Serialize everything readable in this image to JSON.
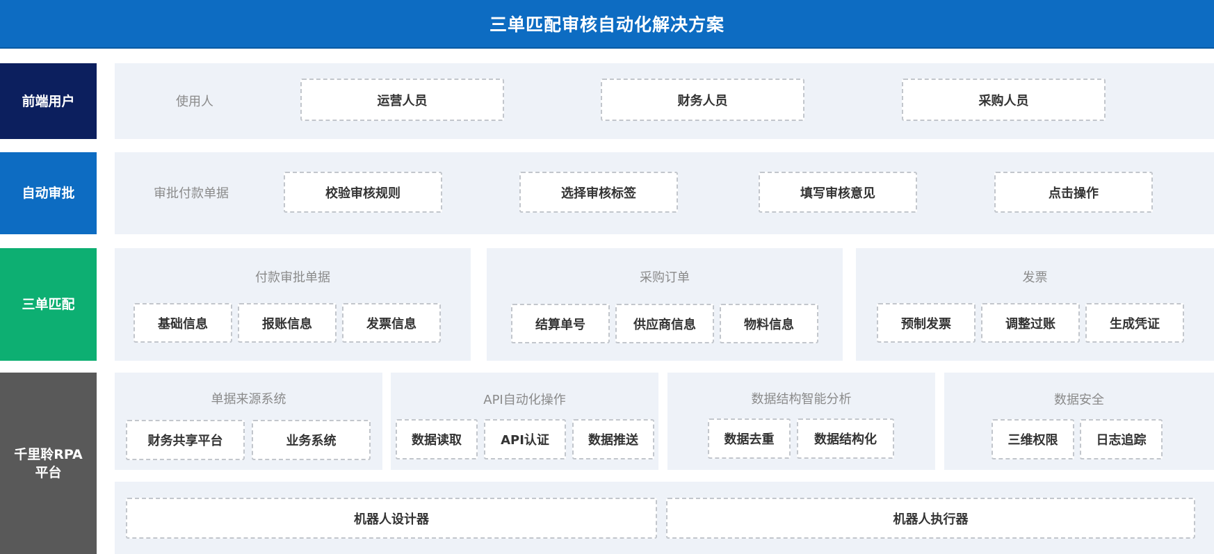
{
  "title": "三单匹配审核自动化解决方案",
  "colors": {
    "title_bar": "#0d6cc2",
    "frontend_users": "#0c1f5e",
    "auto_approval": "#0d6cc2",
    "three_way_match": "#0daf72",
    "rpa_platform": "#595959",
    "panel": "#eef2f8",
    "box_border": "#c2c6cc"
  },
  "rows": {
    "frontend_users": {
      "label": "前端用户",
      "caption": "使用人",
      "items": [
        "运营人员",
        "财务人员",
        "采购人员"
      ]
    },
    "auto_approval": {
      "label": "自动审批",
      "caption": "审批付款单据",
      "items": [
        "校验审核规则",
        "选择审核标签",
        "填写审核意见",
        "点击操作"
      ]
    },
    "three_way_match": {
      "label": "三单匹配",
      "groups": [
        {
          "title": "付款审批单据",
          "items": [
            "基础信息",
            "报账信息",
            "发票信息"
          ]
        },
        {
          "title": "采购订单",
          "items": [
            "结算单号",
            "供应商信息",
            "物料信息"
          ]
        },
        {
          "title": "发票",
          "items": [
            "预制发票",
            "调整过账",
            "生成凭证"
          ]
        }
      ]
    },
    "rpa_platform": {
      "label": "千里聆RPA\n平台",
      "groups": [
        {
          "title": "单据来源系统",
          "items": [
            "财务共享平台",
            "业务系统"
          ]
        },
        {
          "title": "API自动化操作",
          "items": [
            "数据读取",
            "API认证",
            "数据推送"
          ]
        },
        {
          "title": "数据结构智能分析",
          "items": [
            "数据去重",
            "数据结构化"
          ]
        },
        {
          "title": "数据安全",
          "items": [
            "三维权限",
            "日志追踪"
          ]
        }
      ],
      "bottom_items": [
        "机器人设计器",
        "机器人执行器"
      ]
    }
  }
}
